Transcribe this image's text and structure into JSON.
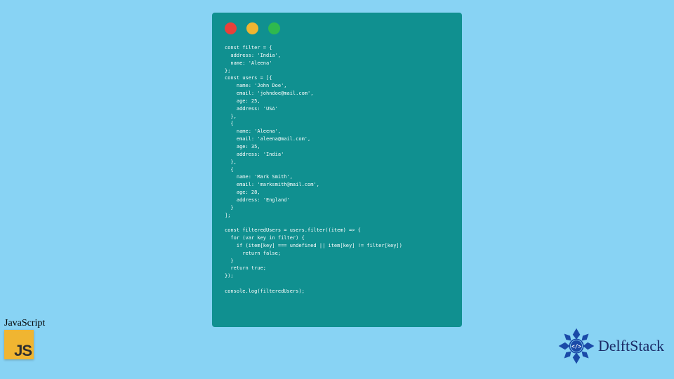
{
  "code_window": {
    "traffic_lights": [
      "red",
      "yellow",
      "green"
    ],
    "code_lines": [
      "const filter = {",
      "  address: 'India',",
      "  name: 'Aleena'",
      "};",
      "const users = [{",
      "    name: 'John Doe',",
      "    email: 'johndoe@mail.com',",
      "    age: 25,",
      "    address: 'USA'",
      "  },",
      "  {",
      "    name: 'Aleena',",
      "    email: 'aleena@mail.com',",
      "    age: 35,",
      "    address: 'India'",
      "  },",
      "  {",
      "    name: 'Mark Smith',",
      "    email: 'marksmith@mail.com',",
      "    age: 28,",
      "    address: 'England'",
      "  }",
      "];",
      "",
      "const filteredUsers = users.filter((item) => {",
      "  for (var key in filter) {",
      "    if (item[key] === undefined || item[key] != filter[key])",
      "      return false;",
      "  }",
      "  return true;",
      "});",
      "",
      "console.log(filteredUsers);"
    ]
  },
  "js_badge": {
    "label": "JavaScript",
    "logo_text": "JS"
  },
  "delftstack": {
    "name": "DelftStack"
  },
  "colors": {
    "page_bg": "#88d3f4",
    "window_bg": "#109090",
    "js_yellow": "#f0b531",
    "delft_blue": "#1a2a66"
  }
}
